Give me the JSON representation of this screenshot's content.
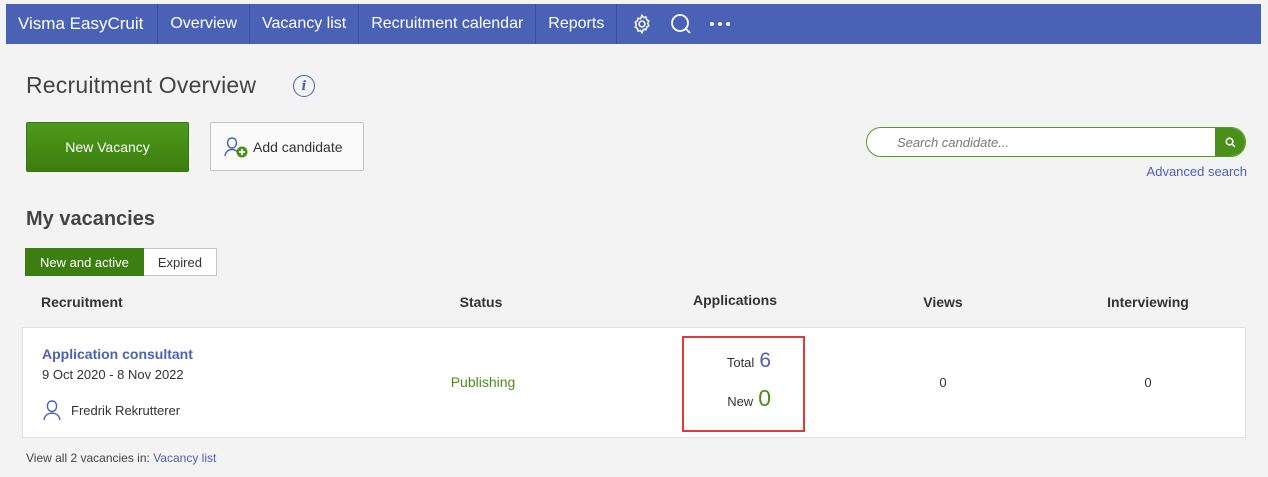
{
  "nav": {
    "brand": "Visma EasyCruit",
    "items": [
      "Overview",
      "Vacancy list",
      "Recruitment calendar",
      "Reports"
    ],
    "icons": [
      "gear-icon",
      "search-icon",
      "more-icon"
    ]
  },
  "page": {
    "title": "Recruitment Overview",
    "new_vacancy": "New Vacancy",
    "add_candidate": "Add candidate",
    "search_placeholder": "Search candidate...",
    "advanced_search": "Advanced search"
  },
  "vacancies": {
    "title": "My vacancies",
    "tabs": [
      "New and active",
      "Expired"
    ],
    "active_tab": "New and active",
    "columns": [
      "Recruitment",
      "Status",
      "Applications",
      "Views",
      "Interviewing"
    ],
    "rows": [
      {
        "title": "Application consultant",
        "dates": "9 Oct 2020 - 8 Nov 2022",
        "recruiter": "Fredrik Rekrutterer",
        "status": "Publishing",
        "total_label": "Total",
        "total": "6",
        "new_label": "New",
        "new": "0",
        "views": "0",
        "interviewing": "0"
      }
    ],
    "footer_prefix": "View all 2 vacancies in:",
    "footer_link": "Vacancy list"
  },
  "colors": {
    "nav_bg": "#4a62b5",
    "primary_green": "#3d7e12",
    "link_blue": "#4a62b5",
    "highlight_red": "#e0393e"
  }
}
